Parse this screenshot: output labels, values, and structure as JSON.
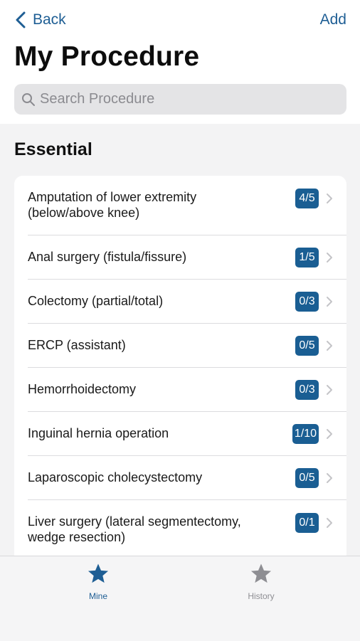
{
  "nav": {
    "back_label": "Back",
    "add_label": "Add"
  },
  "page_title": "My Procedure",
  "search": {
    "placeholder": "Search Procedure",
    "value": ""
  },
  "section": {
    "title": "Essential"
  },
  "procedures": [
    {
      "label": "Amputation of lower extremity\n(below/above knee)",
      "count": "4/5"
    },
    {
      "label": "Anal surgery (fistula/fissure)",
      "count": "1/5"
    },
    {
      "label": "Colectomy (partial/total)",
      "count": "0/3"
    },
    {
      "label": "ERCP (assistant)",
      "count": "0/5"
    },
    {
      "label": "Hemorrhoidectomy",
      "count": "0/3"
    },
    {
      "label": "Inguinal hernia operation",
      "count": "1/10"
    },
    {
      "label": "Laparoscopic cholecystectomy",
      "count": "0/5"
    },
    {
      "label": "Liver surgery (lateral segmentectomy,\nwedge resection)",
      "count": "0/1"
    }
  ],
  "tabs": [
    {
      "label": "Mine",
      "icon": "star-icon",
      "active": true
    },
    {
      "label": "History",
      "icon": "star-icon",
      "active": false
    }
  ],
  "colors": {
    "accent": "#1e5e94",
    "badge": "#1a5e93",
    "inactive_tab": "#8e8e93"
  }
}
